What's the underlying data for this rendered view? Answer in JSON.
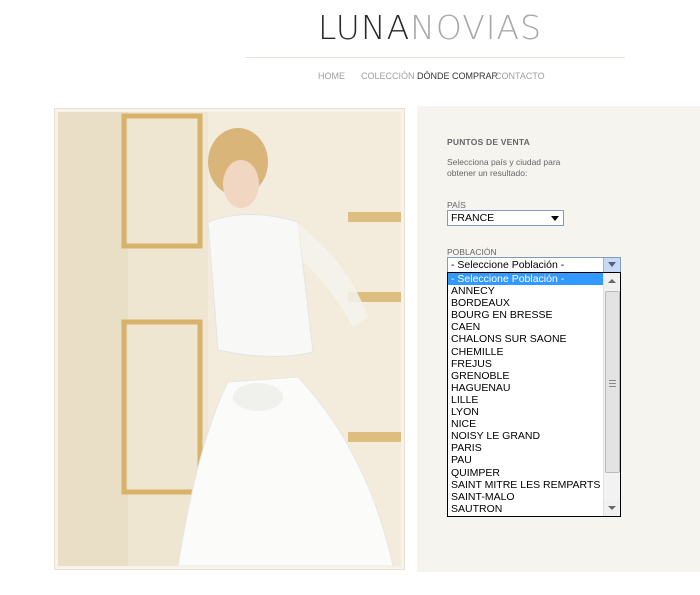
{
  "brand": {
    "part1": "LUNA",
    "part2": "NOVIAS"
  },
  "nav": {
    "items": [
      "HOME",
      "COLECCIÓN",
      "DÓNDE COMPRAR",
      "CONTACTO"
    ],
    "active": "DÓNDE COMPRAR"
  },
  "panel": {
    "title": "PUNTOS DE VENTA",
    "hint": "Selecciona país y ciudad para obtener un resultado:",
    "country_label": "PAÍS",
    "country_value": "FRANCE",
    "city_label": "POBLACIÓN",
    "city_value": "- Seleccione Población -"
  },
  "city_options": [
    "- Seleccione Población -",
    "ANNECY",
    "BORDEAUX",
    "BOURG EN BRESSE",
    "CAEN",
    "CHALONS SUR SAONE",
    "CHEMILLE",
    "FREJUS",
    "GRENOBLE",
    "HAGUENAU",
    "LILLE",
    "LYON",
    "NICE",
    "NOISY LE GRAND",
    "PARIS",
    "PAU",
    "QUIMPER",
    "SAINT MITRE LES REMPARTS",
    "SAINT-MALO",
    "SAUTRON"
  ],
  "colors": {
    "panel_bg": "#f6f4ee",
    "highlight": "#3399ff",
    "nav_active": "#333333",
    "nav": "#a0a0a0"
  }
}
